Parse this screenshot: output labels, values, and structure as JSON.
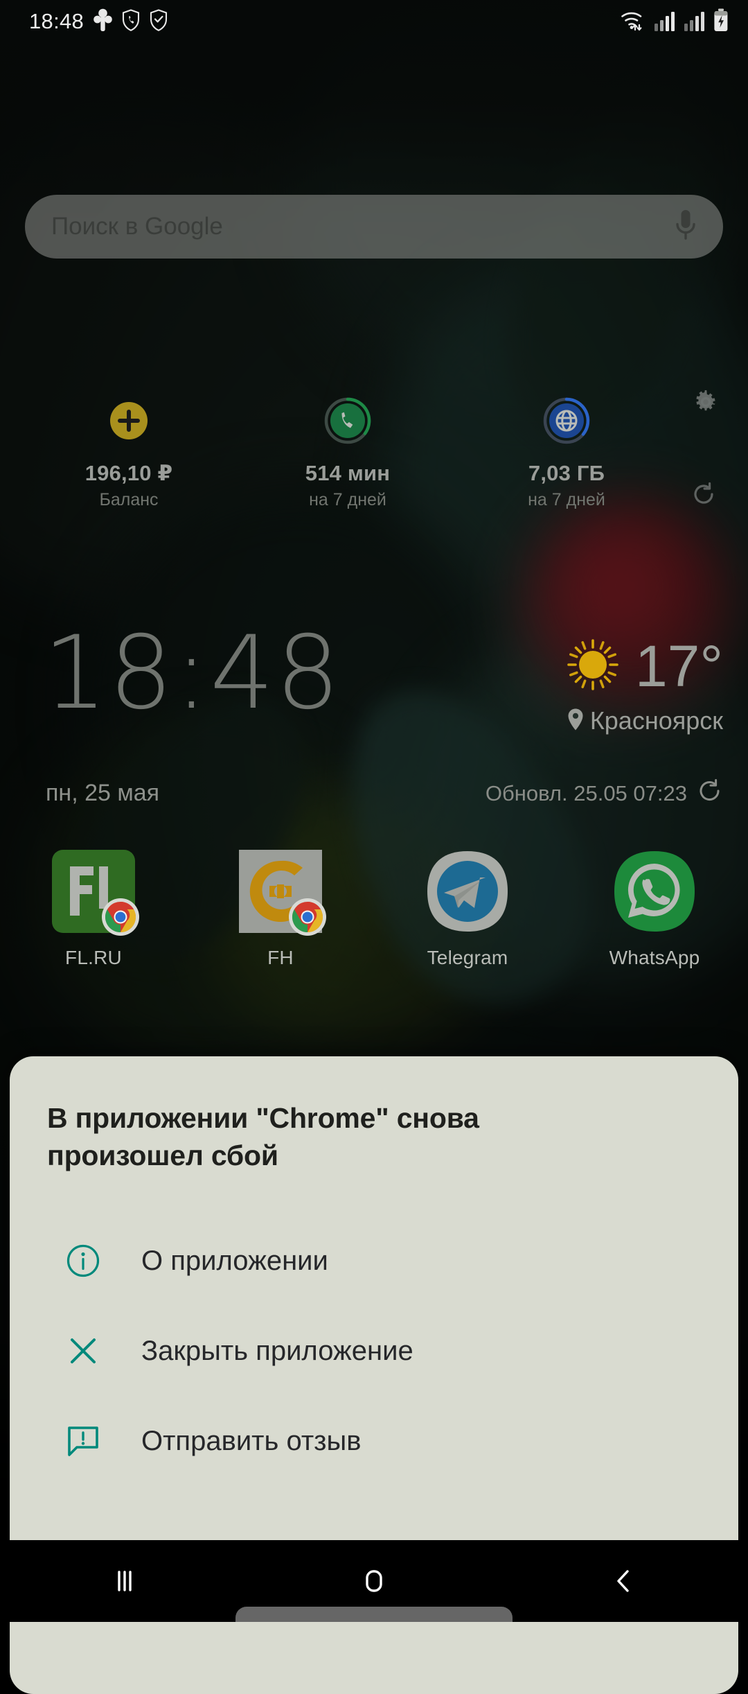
{
  "status_bar": {
    "time": "18:48",
    "left_icons": [
      "clover-icon",
      "shield-phone-icon",
      "shield-check-icon"
    ],
    "right_icons": [
      "wifi-icon",
      "signal-sim1-icon",
      "signal-sim2-icon",
      "battery-charging-icon"
    ]
  },
  "search": {
    "placeholder": "Поиск в Google",
    "mic_icon": "microphone-icon"
  },
  "operator_widget": {
    "gear_icon": "gear-icon",
    "refresh_icon": "refresh-icon",
    "items": [
      {
        "icon": "plus-circle-icon",
        "value": "196,10 ₽",
        "sub": "Баланс",
        "color": "#a9901d"
      },
      {
        "icon": "phone-circle-icon",
        "value": "514 мин",
        "sub": "на 7 дней",
        "color": "#18703e"
      },
      {
        "icon": "globe-circle-icon",
        "value": "7,03 ГБ",
        "sub": "на 7 дней",
        "color": "#1b4591"
      }
    ]
  },
  "clock": {
    "time": "18:48",
    "date": "пн, 25 мая"
  },
  "weather": {
    "icon": "sun-icon",
    "temperature": "17°",
    "pin_icon": "location-pin-icon",
    "city": "Красноярск",
    "updated": "Обновл. 25.05 07:23",
    "refresh_icon": "refresh-icon"
  },
  "apps": [
    {
      "label": "FL.RU",
      "icon": "fl-ru-icon",
      "badge": "chrome-badge-icon"
    },
    {
      "label": "FH",
      "icon": "fh-icon",
      "badge": "chrome-badge-icon"
    },
    {
      "label": "Telegram",
      "icon": "telegram-icon",
      "badge": ""
    },
    {
      "label": "WhatsApp",
      "icon": "whatsapp-icon",
      "badge": ""
    }
  ],
  "crash_dialog": {
    "title": "В приложении \"Chrome\" снова произошел сбой",
    "accent_color": "#00897b",
    "background_color": "#d9dbd0",
    "actions": [
      {
        "icon": "info-circle-icon",
        "label": "О приложении"
      },
      {
        "icon": "close-x-icon",
        "label": "Закрыть приложение"
      },
      {
        "icon": "feedback-bubble-icon",
        "label": "Отправить отзыв"
      }
    ]
  },
  "nav_bar": {
    "recents_label": "recents-icon",
    "home_label": "home-icon",
    "back_label": "back-icon"
  }
}
